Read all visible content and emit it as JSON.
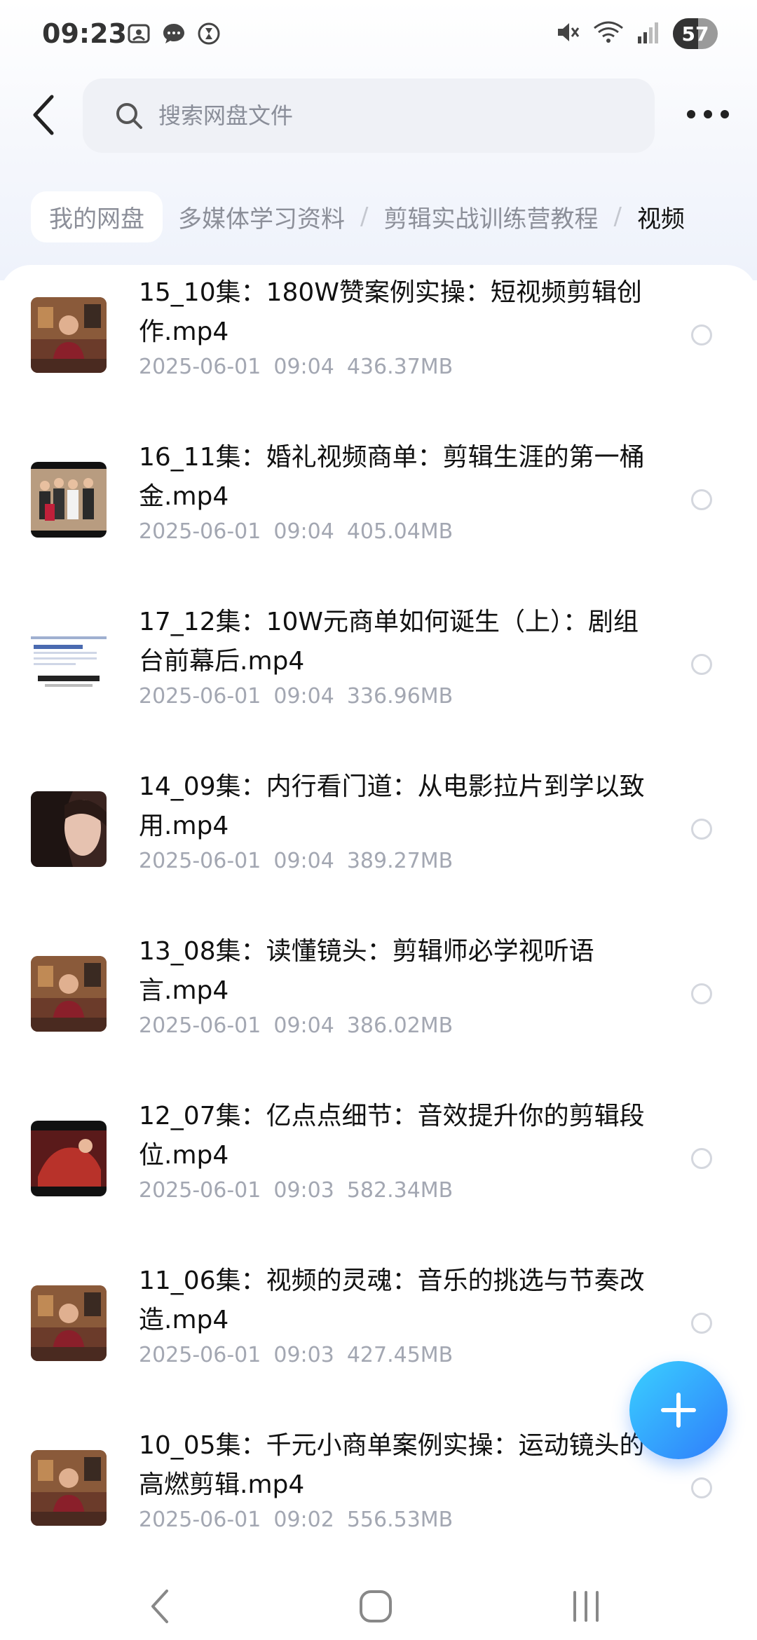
{
  "status_bar": {
    "time": "09:23",
    "battery": "57",
    "battery_level": 0.57,
    "left_icons": [
      "screenshot-icon",
      "message-icon",
      "hourglass-icon"
    ],
    "right_icons": [
      "mute-icon",
      "wifi-icon",
      "signal-icon"
    ]
  },
  "header": {
    "search_placeholder": "搜索网盘文件"
  },
  "breadcrumb": {
    "home": "我的网盘",
    "items": [
      "多媒体学习资料",
      "剪辑实战训练营教程"
    ],
    "current": "视频",
    "separator": "/"
  },
  "files": [
    {
      "name": "15_10集：180W赞案例实操：短视频剪辑创作.mp4",
      "date": "2025-06-01",
      "time": "09:04",
      "size": "436.37MB",
      "thumb": "presenter"
    },
    {
      "name": "16_11集：婚礼视频商单：剪辑生涯的第一桶金.mp4",
      "date": "2025-06-01",
      "time": "09:04",
      "size": "405.04MB",
      "thumb": "family"
    },
    {
      "name": "17_12集：10W元商单如何诞生（上）：剧组台前幕后.mp4",
      "date": "2025-06-01",
      "time": "09:04",
      "size": "336.96MB",
      "thumb": "screen"
    },
    {
      "name": "14_09集：内行看门道：从电影拉片到学以致用.mp4",
      "date": "2025-06-01",
      "time": "09:04",
      "size": "389.27MB",
      "thumb": "portrait"
    },
    {
      "name": "13_08集：读懂镜头：剪辑师必学视听语言.mp4",
      "date": "2025-06-01",
      "time": "09:04",
      "size": "386.02MB",
      "thumb": "presenter"
    },
    {
      "name": "12_07集：亿点点细节：音效提升你的剪辑段位.mp4",
      "date": "2025-06-01",
      "time": "09:03",
      "size": "582.34MB",
      "thumb": "red"
    },
    {
      "name": "11_06集：视频的灵魂：音乐的挑选与节奏改造.mp4",
      "date": "2025-06-01",
      "time": "09:03",
      "size": "427.45MB",
      "thumb": "presenter"
    },
    {
      "name": "10_05集：千元小商单案例实操：运动镜头的高燃剪辑.mp4",
      "date": "2025-06-01",
      "time": "09:02",
      "size": "556.53MB",
      "thumb": "presenter"
    }
  ],
  "fab": {
    "icon": "plus-icon"
  },
  "nav": {
    "icons": [
      "back-nav-icon",
      "home-nav-icon",
      "recents-nav-icon"
    ]
  }
}
